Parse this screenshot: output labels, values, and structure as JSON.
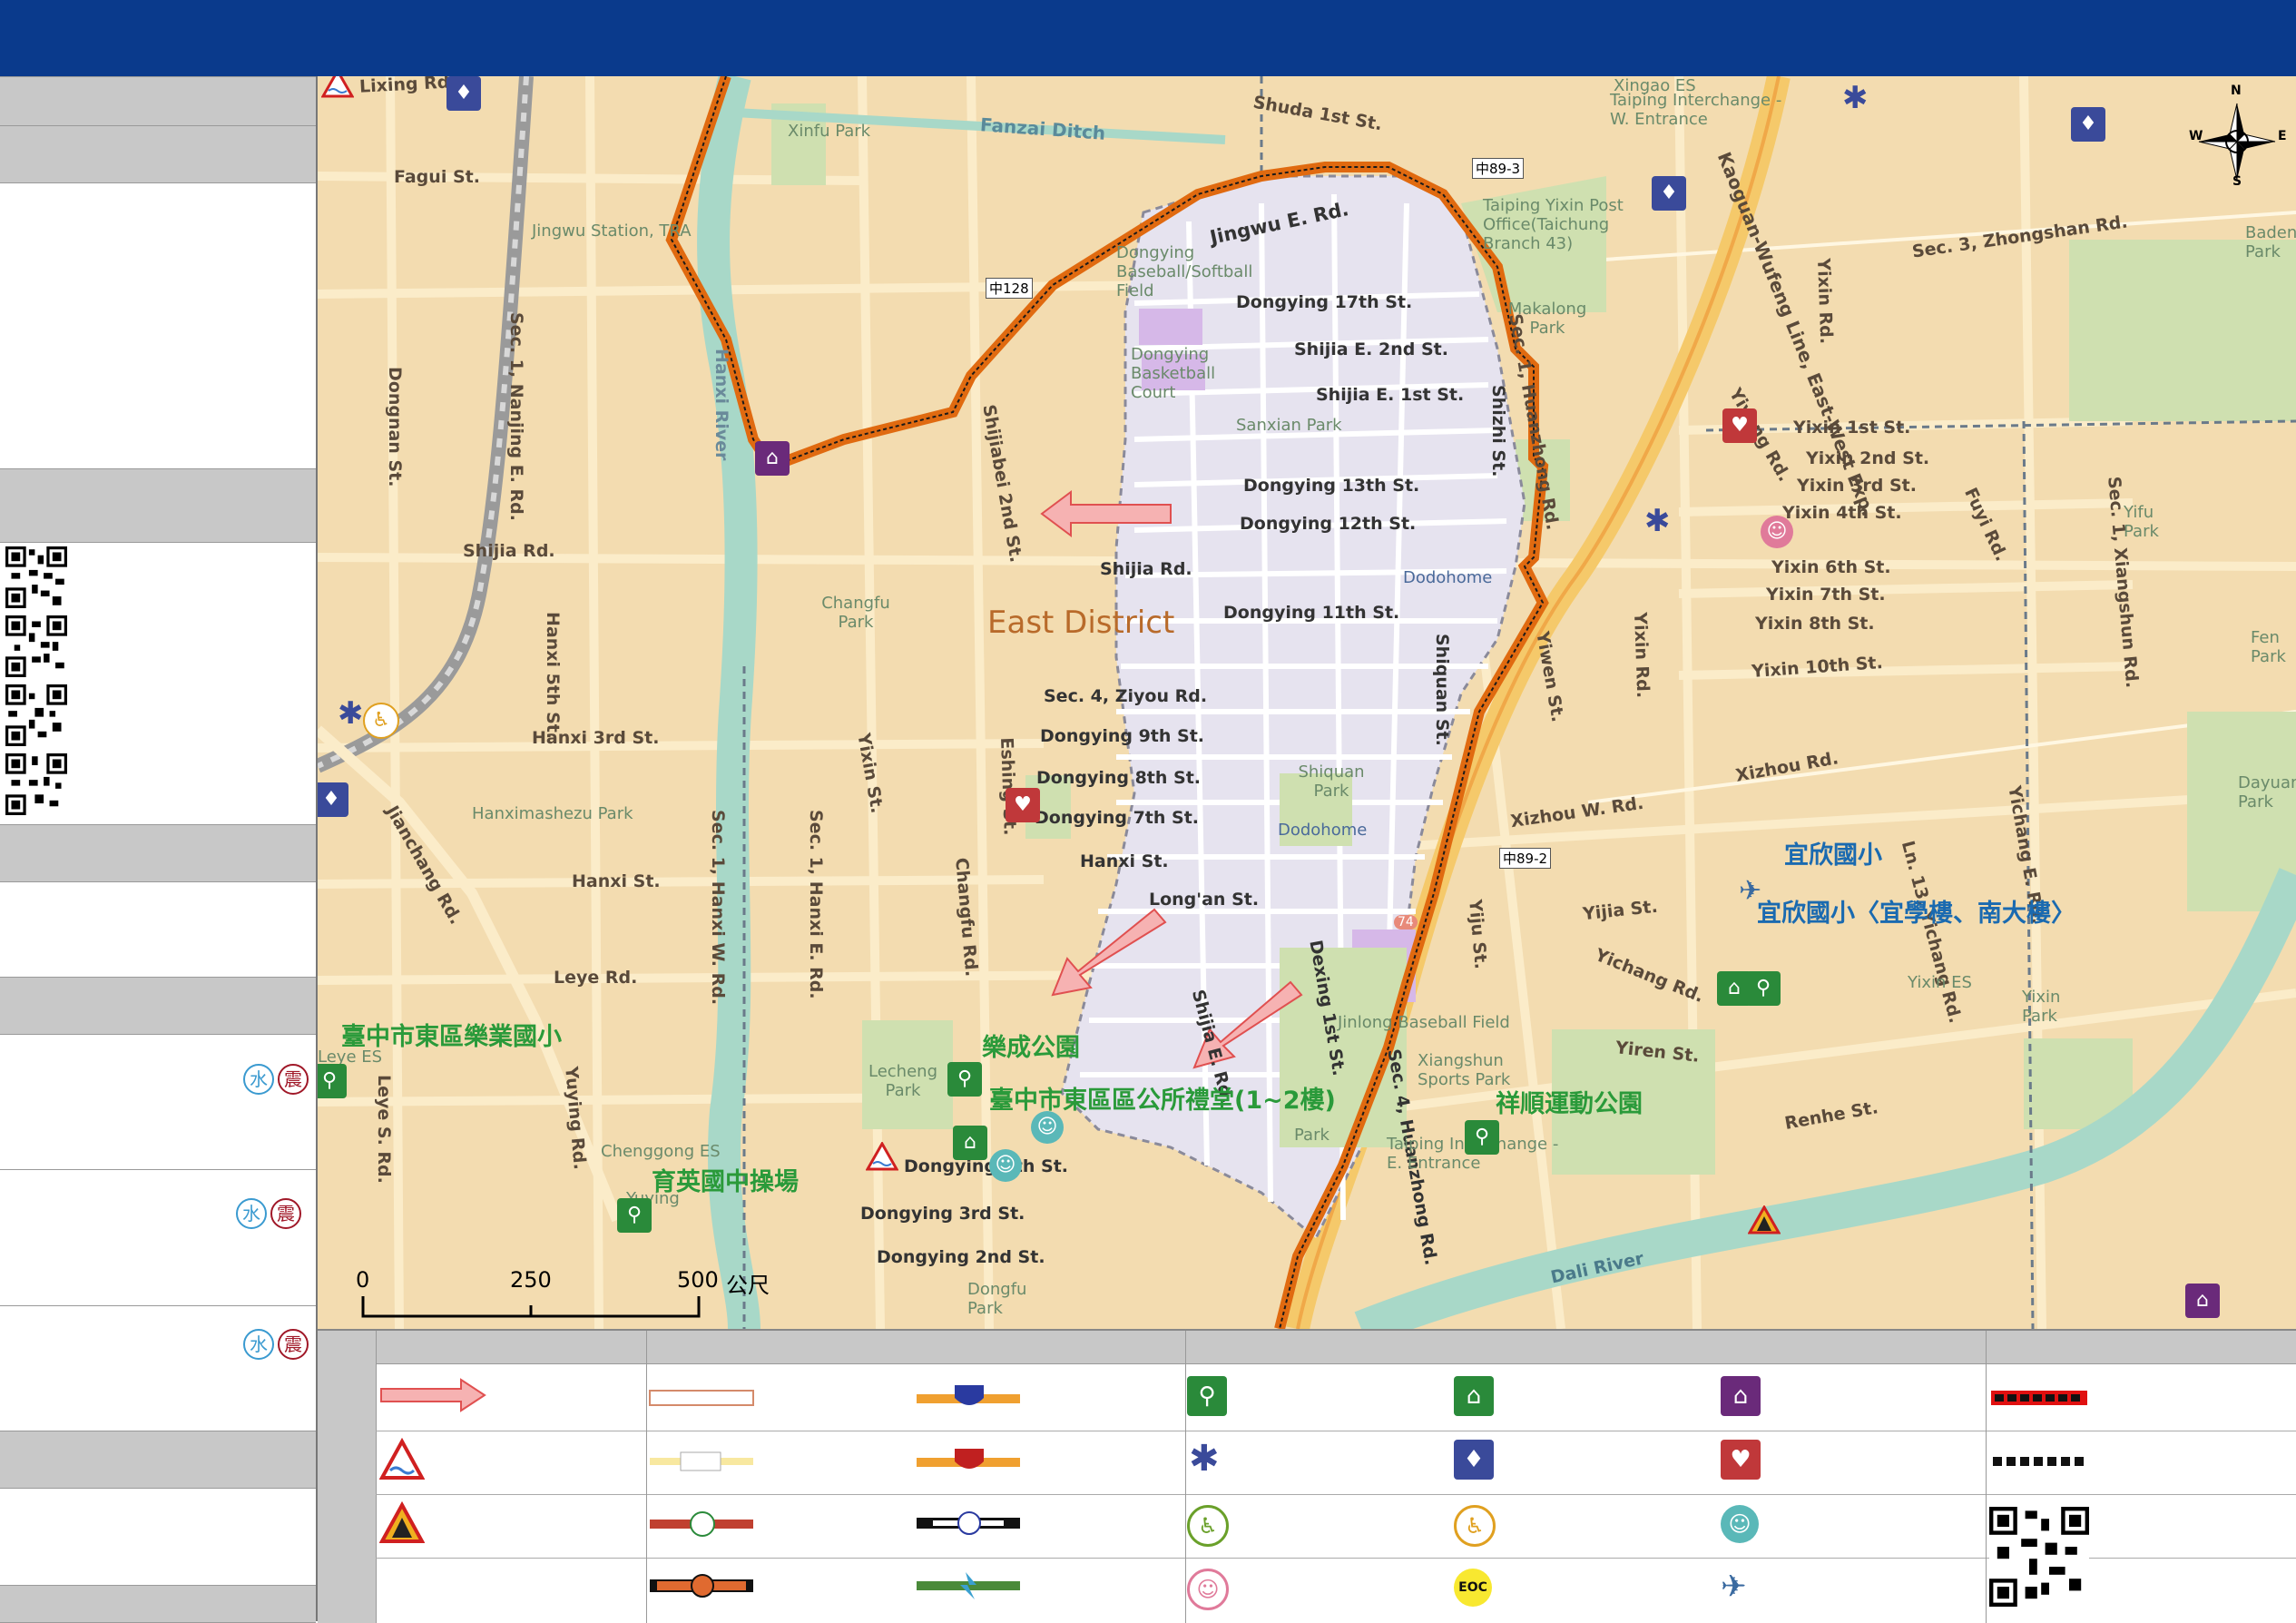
{
  "map": {
    "district_label": "East District",
    "streets": {
      "lixing": "Lixing Rd.",
      "fagui": "Fagui St.",
      "shuda": "Shuda 1st St.",
      "fanzai": "Fanzai Ditch",
      "jingwu_e": "Jingwu E. Rd.",
      "dongying17": "Dongying 17th St.",
      "shijia_e2": "Shijia E. 2nd St.",
      "shijia_e1": "Shijia E. 1st St.",
      "dongying13": "Dongying 13th St.",
      "dongying12": "Dongying 12th St.",
      "shijia_rd_w": "Shijia Rd.",
      "shijia_rd": "Shijia Rd.",
      "dongying11": "Dongying 11th St.",
      "ziyou": "Sec. 4, Ziyou Rd.",
      "dongying9": "Dongying 9th St.",
      "dongying8": "Dongying 8th St.",
      "dongying7": "Dongying 7th St.",
      "hanxi_st": "Hanxi St.",
      "hanxi_st_w": "Hanxi St.",
      "longan": "Long'an St.",
      "leye": "Leye Rd.",
      "hanxi3": "Hanxi 3rd St.",
      "hanxi5": "Hanxi 5th St.",
      "dongnan": "Dongnan St.",
      "nanjing": "Sec. 1, Nanjing E. Rd.",
      "hanxi_river": "Hanxi River",
      "jianchang": "Jianchang Rd.",
      "shijiabei": "Shijiabei 2nd St.",
      "yixin_st": "Yixin St.",
      "eshing": "Eshing St.",
      "hanxi_w": "Sec. 1, Hanxi W. Rd.",
      "hanxi_e": "Sec. 1, Hanxi E. Rd.",
      "changfu_rd": "Changfu Rd.",
      "yuying": "Yuying Rd.",
      "leye_s": "Leye S. Rd.",
      "dongying5": "Dongying 5th St.",
      "dongying3": "Dongying 3rd St.",
      "dongying2": "Dongying 2nd St.",
      "shizhi": "Shizhi St.",
      "shiquan": "Shiquan St.",
      "shijia_e_rd": "Shijia E. Rd.",
      "dexing": "Dexing 1st St.",
      "huanzhong": "Sec. 4, Huanzhong Rd.",
      "yiwen": "Yiwen St.",
      "yixin_rd": "Yixin Rd.",
      "xizhou_w": "Xizhou W. Rd.",
      "xizhou": "Xizhou Rd.",
      "yijia": "Yijia St.",
      "yiju": "Yiju St.",
      "yichang": "Yichang Rd.",
      "yiren": "Yiren St.",
      "renhe": "Renhe St.",
      "dali_river": "Dali River",
      "yixin1": "Yixin 1st St.",
      "yixin2": "Yixin 2nd St.",
      "yixin3": "Yixin 3rd St.",
      "yixin4": "Yixin 4th St.",
      "yixin6": "Yixin 6th St.",
      "yixin7": "Yixin 7th St.",
      "yixin8": "Yixin 8th St.",
      "yixin10": "Yixin 10th St.",
      "zhongshan": "Sec. 3, Zhongshan Rd.",
      "yiyang": "Yiyang Rd.",
      "yixin_rd2": "Yixin Rd.",
      "fuyi": "Fuyi Rd.",
      "xiangshun": "Sec. 1, Xiangshun Rd.",
      "yichang_e": "Yichang E. Rd.",
      "yichang_ln": "Ln. 13, Yichang Rd.",
      "freeway": "Kaoguan-Wufeng Line, East-West Exp.",
      "huanzhong_n": "Sec. 1, Huanzhong Rd.",
      "road_128": "中128",
      "road_89_3": "中89-3",
      "road_89_2": "中89-2",
      "road_74": "74"
    },
    "places": {
      "xinfu": "Xinfu Park",
      "jingwu_station": "Jingwu Station, TRA",
      "dongying_field": "Dongying Baseball/Softball Field",
      "dongying_court": "Dongying Basketball Court",
      "sanxian": "Sanxian Park",
      "changfu_park": "Changfu Park",
      "hanximashezu": "Hanximashezu Park",
      "dodohome1": "Dodohome",
      "dodohome2": "Dodohome",
      "shiquan_park": "Shiquan Park",
      "jinlong": "Jinlong Baseball Field",
      "xiangshun_park": "Xiangshun Sports Park",
      "taiping_e": "Taiping Interchange - E. Entrance",
      "taiping_w": "Taiping Interchange - W. Entrance",
      "xingao": "Xingao ES",
      "taiping_post": "Taiping Yixin Post Office(Taichung Branch 43)",
      "makalong": "Makalong Park",
      "badeng": "Badeng Park",
      "yixin_es": "Yixin ES",
      "yixin_park": "Yixin Park",
      "dayuan": "Dayuan Park",
      "fen_park": "Fen Park",
      "yifu_park": "Yifu Park",
      "lecheng": "Lecheng Park",
      "chenggong": "Chenggong ES",
      "dongfu": "Dongfu Park",
      "leye_es": "Leye ES",
      "yuying_lbl": "Yuying",
      "xinfu2": "Park"
    },
    "shelters": {
      "leye_es": "臺中市東區樂業國小",
      "lecheng": "樂成公園",
      "district_hall": "臺中市東區區公所禮堂(1~2樓)",
      "yuying": "育英國中操場",
      "xiangshun": "祥順運動公園",
      "yixin": "宜欣國小",
      "yixin_bldg": "宜欣國小〈宜學樓、南大樓〉"
    },
    "scale": {
      "zero": "0",
      "mid": "250",
      "end": "500",
      "unit": "公尺"
    },
    "compass": {
      "n": "N",
      "s": "S",
      "e": "E",
      "w": "W"
    }
  },
  "sidebar": {
    "shelter_rows": [
      {
        "water": "水",
        "quake": "震"
      },
      {
        "water": "水",
        "quake": "震"
      },
      {
        "water": "水",
        "quake": "震"
      }
    ]
  },
  "legend": {
    "eoc": "EOC",
    "icons": [
      "arrow-icon",
      "flood-warning-icon",
      "landslide-warning-icon",
      "road-sign-icon",
      "highway-shield-icon",
      "provincial-shield-icon",
      "scenic-road-icon",
      "county-road-icon",
      "rail-icon",
      "expressway-icon",
      "shelter-outdoor-icon",
      "medical-icon",
      "accessible-icon",
      "nursery-icon",
      "shelter-indoor-icon",
      "police-icon",
      "elderly-icon",
      "eoc-icon",
      "social-welfare-icon",
      "fire-station-icon",
      "infant-icon",
      "helicopter-icon",
      "boundary-icon",
      "village-boundary-icon"
    ]
  },
  "colors": {
    "header": "#0a3a8c",
    "band": "#c8c8c8",
    "evac_route": "#e06a10",
    "shelter_green": "#2a9a3a",
    "district_fill": "#e6e3ef",
    "river": "#a8d8c8"
  }
}
